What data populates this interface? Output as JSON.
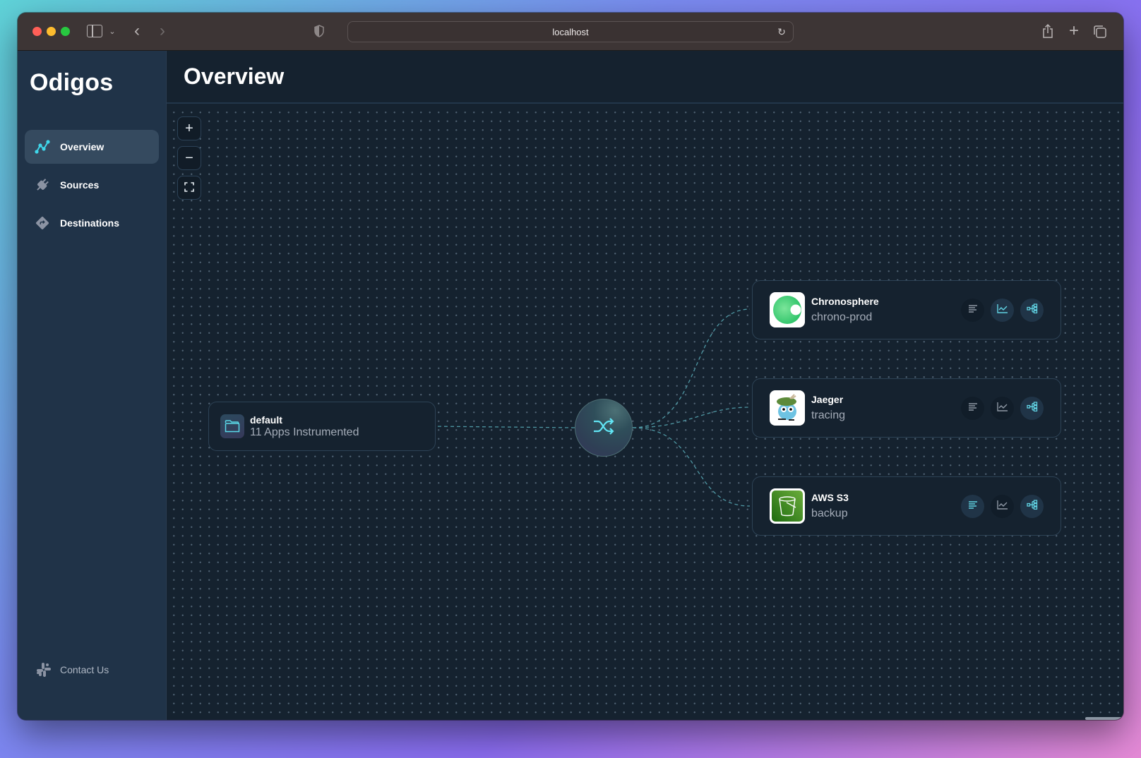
{
  "browser": {
    "url": "localhost",
    "icons": {
      "sidebar_toggle": "sidebar-icon",
      "tab_menu": "chevron-down-icon",
      "back": "chevron-left-icon",
      "forward": "chevron-right-icon",
      "privacy": "shield-icon",
      "reload": "reload-icon",
      "share": "share-icon",
      "new_tab": "plus-icon",
      "tab_overview": "tabs-icon"
    },
    "glyphs": {
      "chev_down": "⌄",
      "back": "‹",
      "forward": "›",
      "reload": "↻",
      "plus": "+"
    }
  },
  "sidebar": {
    "logo": "Odigos",
    "items": [
      {
        "label": "Overview",
        "icon": "overview-graph-icon",
        "active": true
      },
      {
        "label": "Sources",
        "icon": "plug-icon",
        "active": false
      },
      {
        "label": "Destinations",
        "icon": "destination-diamond-icon",
        "active": false
      }
    ],
    "contact": {
      "label": "Contact Us",
      "icon": "slack-icon"
    }
  },
  "header": {
    "title": "Overview"
  },
  "canvas": {
    "controls": {
      "zoom_in": "+",
      "zoom_out": "−",
      "fit": "fit-view-icon"
    },
    "source": {
      "name": "default",
      "subtitle": "11 Apps Instrumented",
      "icon": "folder-icon"
    },
    "processor": {
      "icon": "shuffle-icon"
    },
    "destinations": [
      {
        "name": "Chronosphere",
        "subtitle": "chrono-prod",
        "logo": "chronosphere-logo",
        "signals": {
          "logs": false,
          "metrics": true,
          "traces": true
        }
      },
      {
        "name": "Jaeger",
        "subtitle": "tracing",
        "logo": "jaeger-logo",
        "signals": {
          "logs": false,
          "metrics": false,
          "traces": true
        }
      },
      {
        "name": "AWS S3",
        "subtitle": "backup",
        "logo": "aws-s3-logo",
        "signals": {
          "logs": true,
          "metrics": false,
          "traces": true
        }
      }
    ],
    "signal_icons": {
      "logs": "logs-icon",
      "metrics": "metrics-chart-icon",
      "traces": "traces-icon"
    }
  },
  "colors": {
    "accent": "#61e4f4",
    "sidebar_bg": "#203348",
    "canvas_bg": "#15222f",
    "edge": "#4f97a3",
    "active_item_bg": "#354a5f"
  }
}
